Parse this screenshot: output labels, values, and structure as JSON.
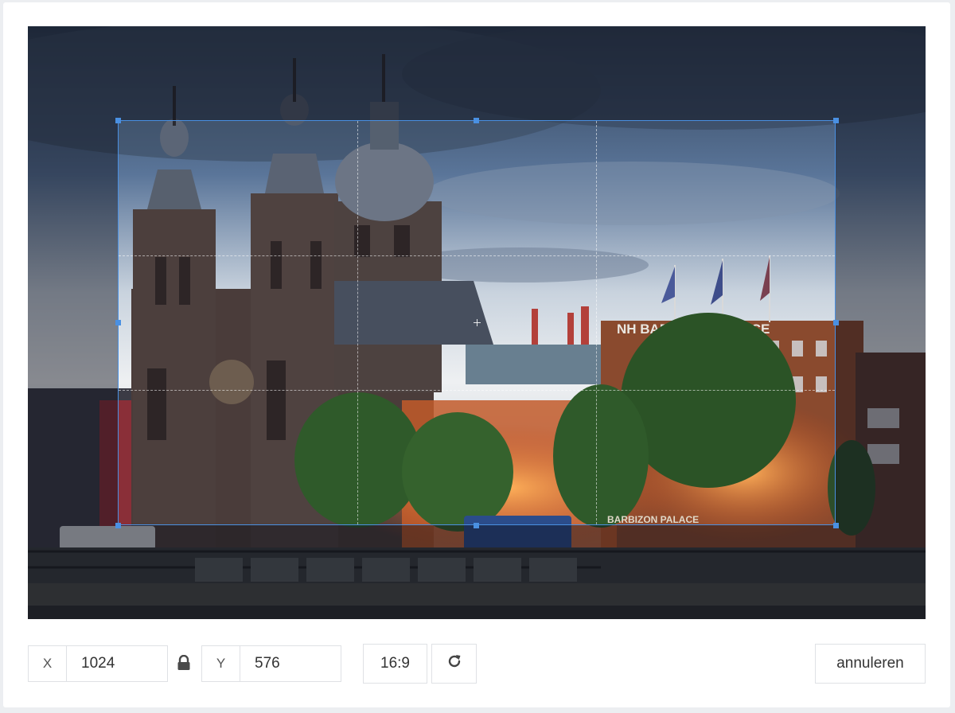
{
  "crop": {
    "x_label": "X",
    "x_value": "1024",
    "y_label": "Y",
    "y_value": "576",
    "aspect_ratio": "16:9",
    "ratio_locked": true
  },
  "actions": {
    "reset_icon": "rotate-cw-icon",
    "lock_icon": "lock-icon",
    "cancel_label": "annuleren"
  },
  "photo": {
    "sign_top": "NH BARBIZON PALACE",
    "sign_bottom": "BARBIZON PALACE"
  },
  "colors": {
    "accent": "#4a90e2",
    "border": "#dfe1e5"
  }
}
